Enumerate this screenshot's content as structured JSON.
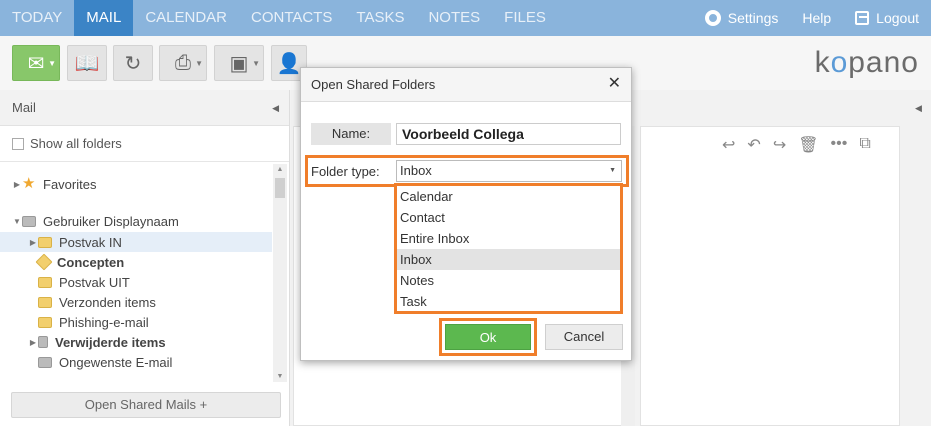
{
  "nav": {
    "tabs": [
      {
        "label": "TODAY"
      },
      {
        "label": "MAIL"
      },
      {
        "label": "CALENDAR"
      },
      {
        "label": "CONTACTS"
      },
      {
        "label": "TASKS"
      },
      {
        "label": "NOTES"
      },
      {
        "label": "FILES"
      }
    ],
    "active_tab": "MAIL",
    "settings_label": "Settings",
    "help_label": "Help",
    "logout_label": "Logout",
    "accent_color": "#3b84c6"
  },
  "brand": {
    "logo_left": "k",
    "logo_o": "o",
    "logo_right": "pano"
  },
  "left_panel": {
    "title": "Mail",
    "show_all_label": "Show all folders",
    "favorites_label": "Favorites",
    "account_label": "Gebruiker Displaynaam",
    "folders": [
      {
        "label": "Postvak IN"
      },
      {
        "label": "Concepten"
      },
      {
        "label": "Postvak UIT"
      },
      {
        "label": "Verzonden items"
      },
      {
        "label": "Phishing-e-mail"
      },
      {
        "label": "Verwijderde items"
      },
      {
        "label": "Ongewenste E-mail"
      }
    ],
    "open_shared_label": "Open Shared Mails +"
  },
  "dialog": {
    "title": "Open Shared Folders",
    "name_label": "Name:",
    "name_value": "Voorbeeld Collega",
    "folder_type_label": "Folder type:",
    "folder_type_value": "Inbox",
    "options": [
      {
        "label": "Calendar"
      },
      {
        "label": "Contact"
      },
      {
        "label": "Entire Inbox"
      },
      {
        "label": "Inbox"
      },
      {
        "label": "Notes"
      },
      {
        "label": "Task"
      }
    ],
    "ok_label": "Ok",
    "cancel_label": "Cancel",
    "highlight_color": "#f07e2a",
    "ok_color": "#5cb84f"
  },
  "icons": {
    "new_mail": "envelope-plus-icon",
    "address_book": "book-icon",
    "refresh": "refresh-icon",
    "print": "printer-icon",
    "view": "layout-icon",
    "contact_card": "contact-card-icon",
    "settings": "gear-icon",
    "logout": "logout-icon",
    "close": "close-icon"
  }
}
